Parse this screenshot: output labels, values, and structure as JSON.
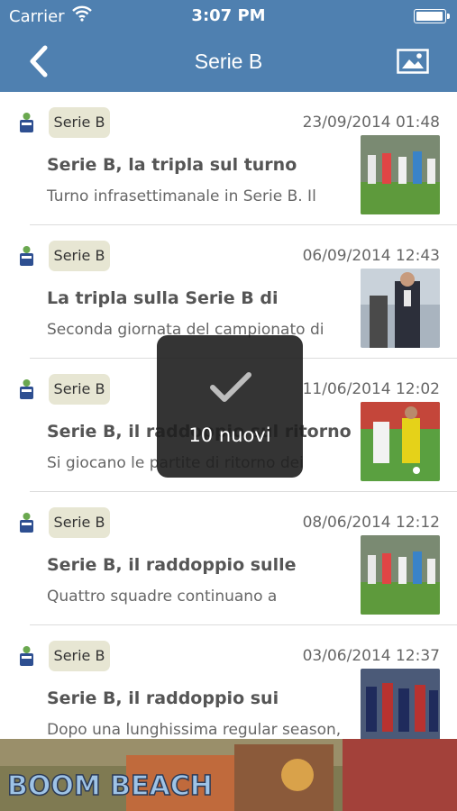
{
  "status_bar": {
    "carrier": "Carrier",
    "time": "3:07 PM"
  },
  "nav": {
    "title": "Serie B",
    "back_icon": "chevron-left-icon",
    "image_icon": "image-icon"
  },
  "articles": [
    {
      "tag": "Serie B",
      "date": "23/09/2014  01:48",
      "title": "Serie B, la tripla sul turno",
      "snippet": "Turno infrasettimanale in Serie B. Il"
    },
    {
      "tag": "Serie B",
      "date": "06/09/2014  12:43",
      "title": "La tripla sulla Serie B di",
      "snippet": "Seconda giornata del campionato di"
    },
    {
      "tag": "Serie B",
      "date": "11/06/2014  12:02",
      "title": "Serie B, il raddoppio sul ritorno",
      "snippet": "Si giocano le partite di ritorno dei"
    },
    {
      "tag": "Serie B",
      "date": "08/06/2014  12:12",
      "title": "Serie B, il raddoppio sulle",
      "snippet": "Quattro squadre continuano a"
    },
    {
      "tag": "Serie B",
      "date": "03/06/2014  12:37",
      "title": "Serie B, il raddoppio sui",
      "snippet": "Dopo una lunghissima regular season,"
    }
  ],
  "toast": {
    "text": "10 nuovi",
    "icon": "checkmark-icon"
  },
  "ad_banner": {
    "text": "BOOM BEACH"
  },
  "colors": {
    "nav": "#4f80b0",
    "chip": "#e7e6d3",
    "toast": "#1e1e1e"
  }
}
